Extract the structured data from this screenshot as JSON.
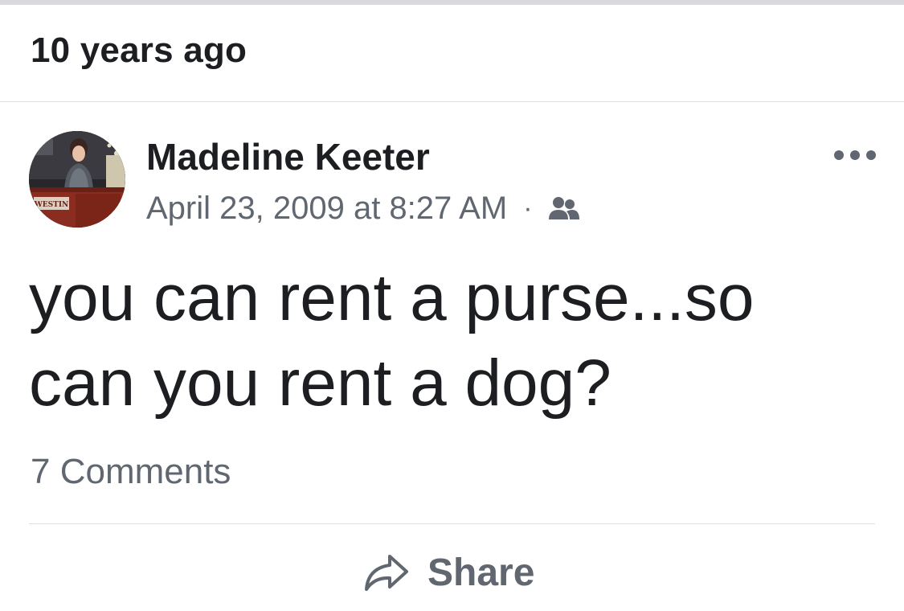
{
  "memory": {
    "header": "10 years ago"
  },
  "post": {
    "author": "Madeline Keeter",
    "timestamp": "April 23, 2009 at 8:27 AM",
    "separator": "·",
    "audience_icon": "friends-icon",
    "avatar_sign_text": "WESTIN",
    "more_icon": "more-options-icon",
    "text_line1": "you can rent a purse...so",
    "text_line2": "can you rent a dog?",
    "comments": "7 Comments"
  },
  "actions": {
    "share_label": "Share",
    "share_icon": "share-arrow-icon"
  },
  "colors": {
    "primary_text": "#1c1e21",
    "secondary_text": "#606770",
    "divider": "#dddfe2"
  }
}
